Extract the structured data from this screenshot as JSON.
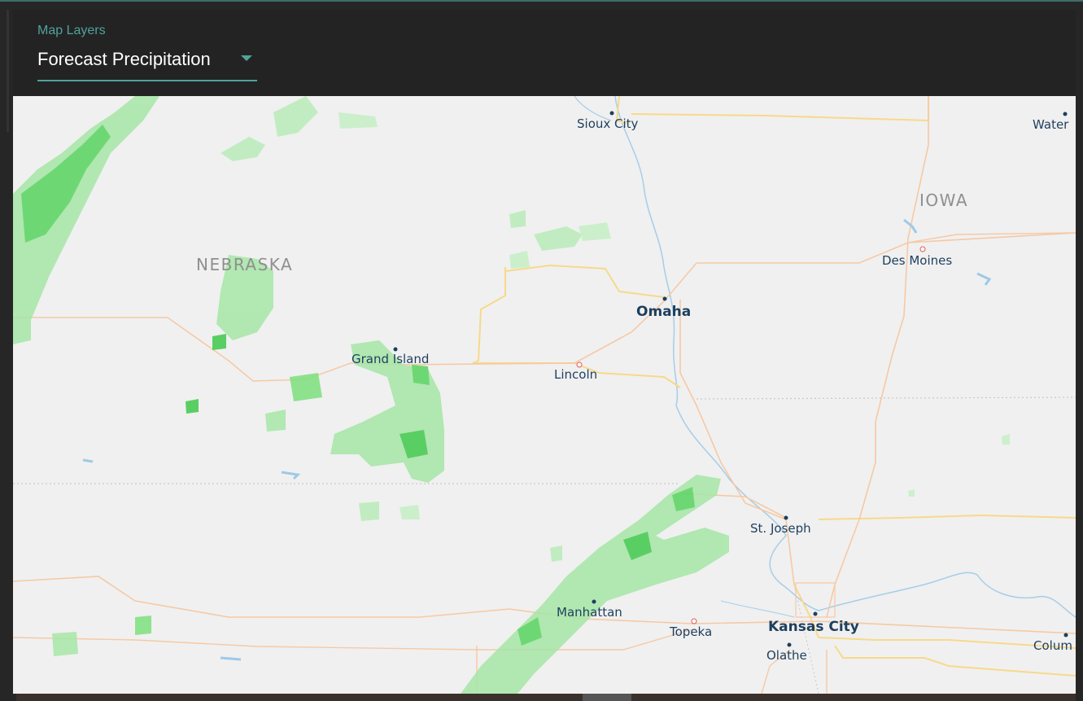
{
  "map_layers": {
    "label": "Map Layers",
    "selected": "Forecast Precipitation"
  },
  "map": {
    "states": [
      "NEBRASKA",
      "IOWA"
    ],
    "cities": [
      {
        "name": "Sioux City",
        "bold": false
      },
      {
        "name": "Water",
        "bold": false
      },
      {
        "name": "Des Moines",
        "bold": false
      },
      {
        "name": "Omaha",
        "bold": true
      },
      {
        "name": "Grand Island",
        "bold": false
      },
      {
        "name": "Lincoln",
        "bold": false
      },
      {
        "name": "St. Joseph",
        "bold": false
      },
      {
        "name": "Manhattan",
        "bold": false
      },
      {
        "name": "Topeka",
        "bold": false
      },
      {
        "name": "Kansas City",
        "bold": true
      },
      {
        "name": "Olathe",
        "bold": false
      },
      {
        "name": "Colum",
        "bold": false
      }
    ]
  },
  "colors": {
    "accent": "#4fa39b",
    "precip_light": "#b9ecb9",
    "precip_mid": "#7ee07e",
    "precip_dark": "#2ebd3e",
    "highway": "#f7d98a",
    "road": "#f6c9a5",
    "water": "#9ec9e8",
    "city_text": "#1e3f5e"
  }
}
